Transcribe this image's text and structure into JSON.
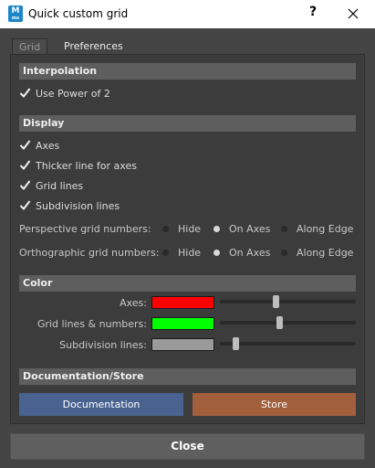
{
  "window": {
    "title": "Quick custom grid",
    "icon_letter": "M",
    "help_label": "?"
  },
  "tabs": [
    {
      "label": "Grid",
      "active": true
    },
    {
      "label": "Preferences",
      "active": false
    }
  ],
  "interpolation": {
    "header": "Interpolation",
    "use_power_of_2": {
      "label": "Use Power of 2",
      "checked": true
    }
  },
  "display": {
    "header": "Display",
    "checkboxes": [
      {
        "label": "Axes",
        "checked": true
      },
      {
        "label": "Thicker line for axes",
        "checked": true
      },
      {
        "label": "Grid lines",
        "checked": true
      },
      {
        "label": "Subdivision lines",
        "checked": true
      }
    ],
    "perspective": {
      "label": "Perspective grid numbers:",
      "options": [
        "Hide",
        "On Axes",
        "Along Edge"
      ],
      "selected": "On Axes"
    },
    "orthographic": {
      "label": "Orthographic grid numbers:",
      "options": [
        "Hide",
        "On Axes",
        "Along Edge"
      ],
      "selected": "On Axes"
    }
  },
  "color": {
    "header": "Color",
    "rows": [
      {
        "label": "Axes:",
        "swatch": "#ff0000",
        "slider_value": 0.41
      },
      {
        "label": "Grid lines & numbers:",
        "swatch": "#00ff00",
        "slider_value": 0.44
      },
      {
        "label": "Subdivision lines:",
        "swatch": "#9a9a9a",
        "slider_value": 0.1
      }
    ]
  },
  "docstore": {
    "header": "Documentation/Store",
    "documentation_label": "Documentation",
    "store_label": "Store"
  },
  "footer": {
    "close_label": "Close"
  },
  "colors": {
    "accent_doc": "#49628f",
    "accent_store": "#a25f3c"
  }
}
